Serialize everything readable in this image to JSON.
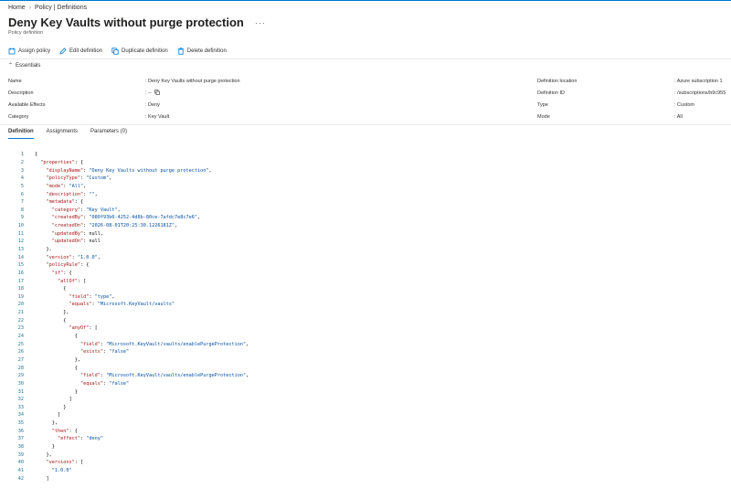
{
  "breadcrumb": {
    "home": "Home",
    "current": "Policy | Definitions"
  },
  "page": {
    "title": "Deny Key Vaults without purge protection",
    "subtitle": "Policy definition",
    "more": "···"
  },
  "toolbar": {
    "assign": "Assign policy",
    "edit": "Edit definition",
    "duplicate": "Duplicate definition",
    "delete": "Delete definition"
  },
  "essentials": {
    "toggle_label": "Essentials",
    "left": [
      {
        "label": "Name",
        "value": ": Deny Key Vaults without purge protection"
      },
      {
        "label": "Description",
        "value": ": --"
      },
      {
        "label": "Available Effects",
        "value": ": Deny"
      },
      {
        "label": "Category",
        "value": ": Key Vault"
      }
    ],
    "right": [
      {
        "label": "Definition location",
        "value": ": Azure subscription 1"
      },
      {
        "label": "Definition ID",
        "value": ": /subscriptions/b9c955"
      },
      {
        "label": "Type",
        "value": ": Custom"
      },
      {
        "label": "Mode",
        "value": ": All"
      }
    ]
  },
  "tabs": [
    "Definition",
    "Assignments",
    "Parameters (0)"
  ],
  "code_lines": [
    "{",
    "  \"properties\": {",
    "    \"displayName\": \"Deny Key Vaults without purge protection\",",
    "    \"policyType\": \"Custom\",",
    "    \"mode\": \"All\",",
    "    \"description\": \"\",",
    "    \"metadata\": {",
    "      \"category\": \"Key Vault\",",
    "      \"createdBy\": \"080f93b6-4252-4d8b-80ce-7afdc7e8c7e6\",",
    "      \"createdOn\": \"2026-08-01T20:25:30.1226181Z\",",
    "      \"updatedBy\": null,",
    "      \"updatedOn\": null",
    "    },",
    "    \"version\": \"1.0.0\",",
    "    \"policyRule\": {",
    "      \"if\": {",
    "        \"allOf\": [",
    "          {",
    "            \"field\": \"type\",",
    "            \"equals\": \"Microsoft.KeyVault/vaults\"",
    "          },",
    "          {",
    "            \"anyOf\": [",
    "              {",
    "                \"field\": \"Microsoft.KeyVault/vaults/enablePurgeProtection\",",
    "                \"exists\": \"false\"",
    "              },",
    "              {",
    "                \"field\": \"Microsoft.KeyVault/vaults/enablePurgeProtection\",",
    "                \"equals\": \"false\"",
    "              }",
    "            ]",
    "          }",
    "        ]",
    "      },",
    "      \"then\": {",
    "        \"effect\": \"deny\"",
    "      }",
    "    },",
    "    \"versions\": [",
    "      \"1.0.0\"",
    "    ]"
  ],
  "colors": {
    "accent": "#0078d4",
    "json_key": "#a31515",
    "json_string": "#0451a5",
    "line_number": "#237893"
  }
}
